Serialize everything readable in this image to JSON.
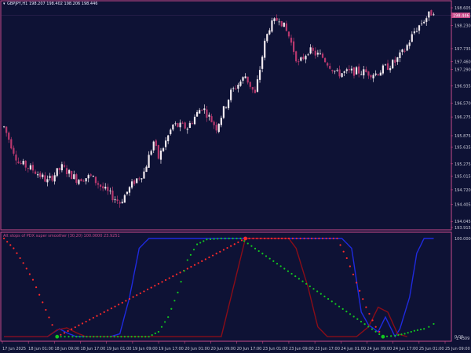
{
  "header": {
    "symbol": "GBPJPY,H1",
    "quote": "198.207 198.402 198.206 198.446"
  },
  "indicator": {
    "title": "Alt stops of PDX super smoother (30,20) 100.0000 23.9251"
  },
  "colors": {
    "background": "#0e1235",
    "frame": "#c84a8a",
    "bull_candle": "#f2eaf0",
    "bear_candle": "#b8386e",
    "price_tag": "#c84a8a",
    "smoother_up": "#1f2adf",
    "smoother_down": "#8a0d18",
    "stop_up": "#12c820",
    "stop_down": "#ff2a2a"
  },
  "chart_data": [
    {
      "type": "candlestick",
      "symbol": "GBPJPY,H1",
      "y_ticks": [
        "198.605",
        "198.446",
        "198.230",
        "197.735",
        "197.460",
        "197.290",
        "196.935",
        "196.570",
        "196.275",
        "195.875",
        "195.635",
        "195.275",
        "195.015",
        "194.720",
        "194.405",
        "194.045",
        "193.915"
      ],
      "x_ticks": [
        "17 Jun 2025",
        "18 Jun 01:00",
        "18 Jun 09:00",
        "18 Jun 17:00",
        "19 Jun 01:00",
        "19 Jun 09:00",
        "19 Jun 17:00",
        "20 Jun 01:00",
        "20 Jun 09:00",
        "20 Jun 17:00",
        "23 Jun 01:00",
        "23 Jun 09:00",
        "23 Jun 17:00",
        "24 Jun 01:00",
        "24 Jun 09:00",
        "24 Jun 17:00",
        "25 Jun 01:00",
        "25 Jun 09:00"
      ],
      "current_price": "198.446",
      "close_path": [
        [
          0,
          196.06
        ],
        [
          6,
          195.3
        ],
        [
          12,
          195.15
        ],
        [
          18,
          194.9
        ],
        [
          24,
          195.2
        ],
        [
          30,
          194.95
        ],
        [
          36,
          195.0
        ],
        [
          42,
          194.7
        ],
        [
          48,
          194.45
        ],
        [
          54,
          194.9
        ],
        [
          58,
          195.1
        ],
        [
          62,
          195.75
        ],
        [
          64,
          195.4
        ],
        [
          70,
          196.1
        ],
        [
          76,
          196.05
        ],
        [
          82,
          196.5
        ],
        [
          88,
          196.05
        ],
        [
          94,
          196.8
        ],
        [
          100,
          197.15
        ],
        [
          104,
          196.75
        ],
        [
          108,
          197.85
        ],
        [
          110,
          198.2
        ],
        [
          114,
          198.4
        ],
        [
          118,
          198.0
        ],
        [
          122,
          197.4
        ],
        [
          126,
          197.7
        ],
        [
          132,
          197.55
        ],
        [
          138,
          197.2
        ],
        [
          146,
          197.25
        ],
        [
          154,
          197.2
        ],
        [
          162,
          197.45
        ],
        [
          166,
          197.7
        ],
        [
          170,
          198.1
        ],
        [
          174,
          198.35
        ],
        [
          178,
          198.55
        ]
      ]
    },
    {
      "type": "line",
      "title": "Alt stops of PDX super smoother (30,20) 100.0000 23.9251",
      "y_ticks": [
        "100.0000",
        "0.00",
        "-1.4309"
      ],
      "ylim": [
        -1.4309,
        100
      ],
      "series": [
        {
          "style": "line",
          "color": "#1f2adf",
          "values": [
            [
              0,
              0
            ],
            [
              18,
              0
            ],
            [
              21,
              5
            ],
            [
              23,
              8
            ],
            [
              26,
              4
            ],
            [
              30,
              0
            ],
            [
              44,
              0
            ],
            [
              48,
              3
            ],
            [
              52,
              40
            ],
            [
              56,
              90
            ],
            [
              60,
              100
            ],
            [
              120,
              100
            ],
            [
              140,
              100
            ],
            [
              144,
              90
            ],
            [
              148,
              25
            ],
            [
              151,
              12
            ],
            [
              155,
              5
            ],
            [
              158,
              20
            ],
            [
              162,
              0
            ],
            [
              164,
              8
            ],
            [
              168,
              40
            ],
            [
              171,
              85
            ],
            [
              174,
              100
            ],
            [
              178,
              100
            ]
          ]
        },
        {
          "style": "line",
          "color": "#8a0d18",
          "values": [
            [
              0,
              0
            ],
            [
              18,
              0
            ],
            [
              22,
              7
            ],
            [
              26,
              9
            ],
            [
              30,
              4
            ],
            [
              34,
              0
            ],
            [
              90,
              0
            ],
            [
              100,
              100
            ],
            [
              118,
              100
            ],
            [
              121,
              90
            ],
            [
              126,
              50
            ],
            [
              130,
              10
            ],
            [
              134,
              0
            ],
            [
              146,
              0
            ],
            [
              151,
              10
            ],
            [
              155,
              30
            ],
            [
              159,
              25
            ],
            [
              163,
              3
            ],
            [
              167,
              0
            ]
          ]
        },
        {
          "style": "dots",
          "color": "#ff2a2a",
          "values": [
            [
              0,
              100
            ],
            [
              4,
              90
            ],
            [
              8,
              75
            ],
            [
              12,
              58
            ],
            [
              16,
              35
            ],
            [
              20,
              12
            ],
            [
              22,
              0
            ],
            [
              100,
              100
            ],
            [
              108,
              100
            ],
            [
              118,
              100
            ],
            [
              126,
              100
            ],
            [
              132,
              100
            ],
            [
              138,
              100
            ],
            [
              142,
              80
            ],
            [
              146,
              55
            ],
            [
              150,
              30
            ],
            [
              154,
              10
            ],
            [
              157,
              0
            ]
          ]
        },
        {
          "style": "dots",
          "color": "#12c820",
          "values": [
            [
              22,
              0
            ],
            [
              30,
              0
            ],
            [
              40,
              0
            ],
            [
              50,
              0
            ],
            [
              60,
              0
            ],
            [
              64,
              5
            ],
            [
              68,
              20
            ],
            [
              72,
              45
            ],
            [
              76,
              78
            ],
            [
              80,
              94
            ],
            [
              84,
              99
            ],
            [
              90,
              100
            ],
            [
              98,
              100
            ],
            [
              157,
              0
            ],
            [
              162,
              1
            ],
            [
              166,
              3
            ],
            [
              170,
              6
            ],
            [
              174,
              8
            ],
            [
              176,
              10
            ],
            [
              178,
              13
            ]
          ]
        }
      ]
    }
  ]
}
